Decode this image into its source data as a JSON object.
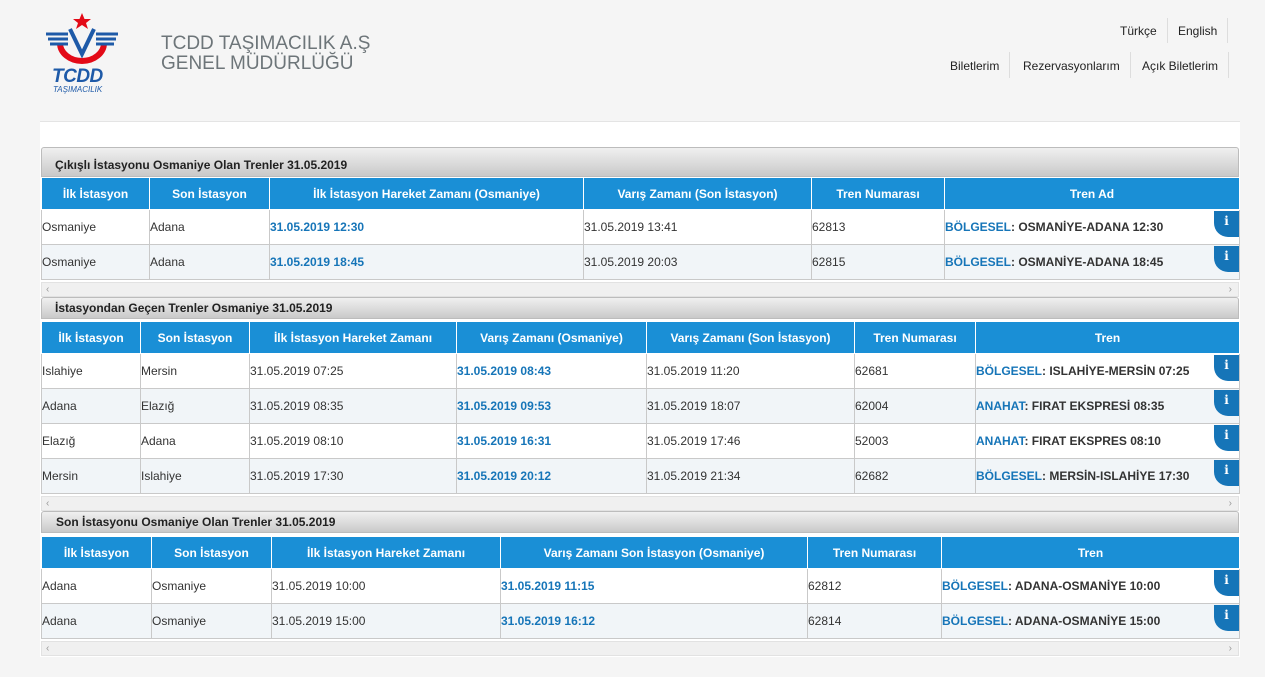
{
  "header": {
    "logo_text": "TCDD",
    "logo_sub": "TAŞIMACILIK",
    "company_line1": "TCDD TAŞIMACILIK A.Ş",
    "company_line2": "GENEL MÜDÜRLÜĞÜ",
    "lang_tr": "Türkçe",
    "lang_en": "English",
    "nav_biletlerim": "Biletlerim",
    "nav_rezervasyon": "Rezervasyonlarım",
    "nav_acik": "Açık Biletlerim"
  },
  "section1": {
    "title": "Çıkışlı İstasyonu Osmaniye Olan Trenler 31.05.2019",
    "headers": [
      "İlk İstasyon",
      "Son İstasyon",
      "İlk İstasyon Hareket Zamanı (Osmaniye)",
      "Varış Zamanı (Son İstasyon)",
      "Tren Numarası",
      "Tren Ad"
    ],
    "rows": [
      {
        "c1": "Osmaniye",
        "c2": "Adana",
        "c3": "31.05.2019 12:30",
        "c4": "31.05.2019 13:41",
        "c5": "62813",
        "cat": "BÖLGESEL",
        "name": ": OSMANİYE-ADANA 12:30"
      },
      {
        "c1": "Osmaniye",
        "c2": "Adana",
        "c3": "31.05.2019 18:45",
        "c4": "31.05.2019 20:03",
        "c5": "62815",
        "cat": "BÖLGESEL",
        "name": ": OSMANİYE-ADANA 18:45"
      }
    ]
  },
  "section2": {
    "title": "İstasyondan Geçen Trenler Osmaniye 31.05.2019",
    "headers": [
      "İlk İstasyon",
      "Son İstasyon",
      "İlk İstasyon Hareket Zamanı",
      "Varış Zamanı (Osmaniye)",
      "Varış Zamanı (Son İstasyon)",
      "Tren Numarası",
      "Tren"
    ],
    "rows": [
      {
        "c1": "Islahiye",
        "c2": "Mersin",
        "c3": "31.05.2019 07:25",
        "c4": "31.05.2019 08:43",
        "c5": "31.05.2019 11:20",
        "c6": "62681",
        "cat": "BÖLGESEL",
        "name": ": ISLAHİYE-MERSİN 07:25"
      },
      {
        "c1": "Adana",
        "c2": "Elazığ",
        "c3": "31.05.2019 08:35",
        "c4": "31.05.2019 09:53",
        "c5": "31.05.2019 18:07",
        "c6": "62004",
        "cat": "ANAHAT",
        "name": ": FIRAT EKSPRESİ 08:35"
      },
      {
        "c1": "Elazığ",
        "c2": "Adana",
        "c3": "31.05.2019 08:10",
        "c4": "31.05.2019 16:31",
        "c5": "31.05.2019 17:46",
        "c6": "52003",
        "cat": "ANAHAT",
        "name": ": FIRAT EKSPRES 08:10"
      },
      {
        "c1": "Mersin",
        "c2": "Islahiye",
        "c3": "31.05.2019 17:30",
        "c4": "31.05.2019 20:12",
        "c5": "31.05.2019 21:34",
        "c6": "62682",
        "cat": "BÖLGESEL",
        "name": ": MERSİN-ISLAHİYE 17:30"
      }
    ]
  },
  "section3": {
    "title": "Son İstasyonu Osmaniye Olan Trenler 31.05.2019",
    "headers": [
      "İlk İstasyon",
      "Son İstasyon",
      "İlk İstasyon Hareket Zamanı",
      "Varış Zamanı Son İstasyon (Osmaniye)",
      "Tren Numarası",
      "Tren"
    ],
    "rows": [
      {
        "c1": "Adana",
        "c2": "Osmaniye",
        "c3": "31.05.2019 10:00",
        "c4": "31.05.2019 11:15",
        "c5": "62812",
        "cat": "BÖLGESEL",
        "name": ": ADANA-OSMANİYE 10:00"
      },
      {
        "c1": "Adana",
        "c2": "Osmaniye",
        "c3": "31.05.2019 15:00",
        "c4": "31.05.2019 16:12",
        "c5": "62814",
        "cat": "BÖLGESEL",
        "name": ": ADANA-OSMANİYE 15:00"
      }
    ]
  },
  "info_glyph": "i",
  "scroll_left": "‹",
  "scroll_right": "›",
  "colors": {
    "header_blue": "#1a8fd6",
    "link_blue": "#1675b8"
  }
}
